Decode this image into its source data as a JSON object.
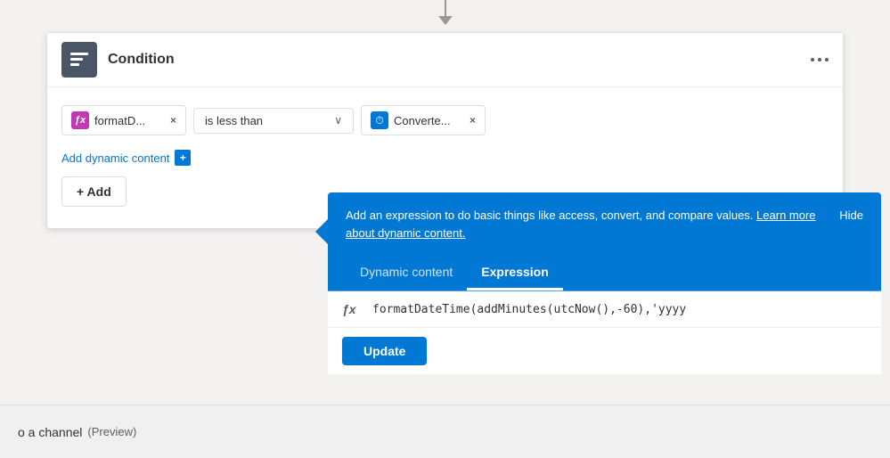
{
  "connector": {
    "icon": "▼"
  },
  "card": {
    "title": "Condition",
    "icon": "⊞",
    "more_options_label": "more options"
  },
  "condition_row": {
    "token1_text": "formatD...",
    "token1_close": "×",
    "operator_text": "is less than",
    "token2_text": "Converte...",
    "token2_close": "×"
  },
  "add_dynamic": {
    "link_text": "Add dynamic content",
    "badge_text": "+"
  },
  "add_button": {
    "label": "+ Add",
    "chevron": "∨"
  },
  "popup": {
    "description": "Add an expression to do basic things like access, convert, and compare values.",
    "link_text": "Learn more about dynamic content.",
    "hide_label": "Hide",
    "arrow_label": "◀",
    "tabs": [
      {
        "label": "Dynamic content",
        "active": false
      },
      {
        "label": "Expression",
        "active": true
      }
    ],
    "fx_label": "ƒx",
    "expression_value": "formatDateTime(addMinutes(utcNow(),-60),'yyyy",
    "update_label": "Update"
  },
  "bottom": {
    "text": "o a channel",
    "preview_text": "(Preview)"
  }
}
